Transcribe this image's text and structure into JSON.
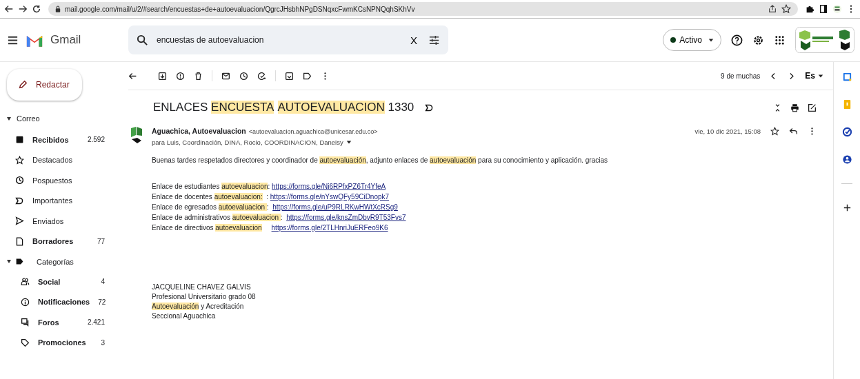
{
  "browser": {
    "url": "mail.google.com/mail/u/2/#search/encuestas+de+autoevaluacion/QgrcJHsbhNPgDSNqxcFwmKCsNPNQqhSKhVv"
  },
  "app": {
    "name": "Gmail"
  },
  "search": {
    "value": "encuestas de autoevaluacion",
    "clear": "X"
  },
  "status": {
    "label": "Activo"
  },
  "compose": {
    "label": "Redactar"
  },
  "mail_section": {
    "label": "Correo",
    "expanded": true
  },
  "folders": [
    {
      "label": "Recibidos",
      "count": "2.592",
      "unread": true
    },
    {
      "label": "Destacados",
      "unread": false
    },
    {
      "label": "Pospuestos",
      "unread": false
    },
    {
      "label": "Importantes",
      "unread": false
    },
    {
      "label": "Enviados",
      "unread": false
    },
    {
      "label": "Borradores",
      "count": "77",
      "unread": true
    }
  ],
  "categories": {
    "label": "Categorías",
    "expanded": true,
    "items": [
      {
        "label": "Social",
        "count": "4",
        "unread": true
      },
      {
        "label": "Notificaciones",
        "count": "72",
        "unread": true
      },
      {
        "label": "Foros",
        "count": "2.421",
        "unread": true
      },
      {
        "label": "Promociones",
        "count": "3",
        "unread": true
      }
    ]
  },
  "toolbar": {
    "position": "9 de muchas",
    "language": "Es"
  },
  "message": {
    "subject": [
      {
        "text": "ENLACES ",
        "kind": "plain"
      },
      {
        "text": "ENCUESTA",
        "kind": "highlight"
      },
      {
        "text": "AUTOEVALUACION",
        "kind": "highlight"
      },
      {
        "text": " 1330",
        "kind": "plain"
      }
    ],
    "important": true,
    "sender_name": "Aguachica, Autoevaluacion",
    "sender_email": "<autoevaluacion.aguachica@unicesar.edu.co>",
    "recipients": "para Luis, Coordinación, DINA, Rocio, COORDINACION, Daneisy",
    "date": "vie, 10 dic 2021, 15:08",
    "intro": [
      {
        "text": "Buenas tardes respetados directores y coordinador de ",
        "kind": "plain"
      },
      {
        "text": "autoevaluación",
        "kind": "highlight"
      },
      {
        "text": ", adjunto enlaces de ",
        "kind": "plain"
      },
      {
        "text": "autoevaluación",
        "kind": "highlight"
      },
      {
        "text": " para su conocimiento y aplicación. gracias",
        "kind": "plain"
      }
    ],
    "links": [
      [
        {
          "text": "Enlace de estudiantes ",
          "kind": "plain"
        },
        {
          "text": "autoevaluacion",
          "kind": "highlight"
        },
        {
          "text": ": ",
          "kind": "plain"
        },
        {
          "text": "https://forms.gle/Ni6RPfxPZ6Tr4YfeA",
          "kind": "link"
        }
      ],
      [
        {
          "text": "Enlace de docentes ",
          "kind": "plain"
        },
        {
          "text": "autoevaluacion:",
          "kind": "highlight"
        },
        {
          "text": "  : ",
          "kind": "plain"
        },
        {
          "text": "https://forms.gle/nYswQFy59CiDnopk7",
          "kind": "link"
        }
      ],
      [
        {
          "text": "Enlace de egresados ",
          "kind": "plain"
        },
        {
          "text": "autoevaluacion ",
          "kind": "highlight"
        },
        {
          "text": ":  ",
          "kind": "plain"
        },
        {
          "text": "https://forms.gle/uP9RLRKwHWtXcRSg9",
          "kind": "link"
        }
      ],
      [
        {
          "text": "Enlace de administrativos ",
          "kind": "plain"
        },
        {
          "text": "autoevaluacion ",
          "kind": "highlight"
        },
        {
          "text": ":  ",
          "kind": "plain"
        },
        {
          "text": "https://forms.gle/knsZmDbvR9T53Fvs7",
          "kind": "link"
        }
      ],
      [
        {
          "text": "Enlace de directivos ",
          "kind": "plain"
        },
        {
          "text": "autoevaluacion",
          "kind": "highlight"
        },
        {
          "text": "https://forms.gle/2TLHnriJuERFeo9K6",
          "kind": "link"
        }
      ]
    ],
    "signature": [
      [
        {
          "text": "JACQUELINE CHAVEZ GALVIS",
          "kind": "plain"
        }
      ],
      [
        {
          "text": "Profesional Universitario grado 08",
          "kind": "plain"
        }
      ],
      [
        {
          "text": "Autoevaluación",
          "kind": "highlight"
        },
        {
          "text": " y Acreditación",
          "kind": "plain"
        }
      ],
      [
        {
          "text": "Seccional Aguachica",
          "kind": "plain"
        }
      ]
    ]
  }
}
